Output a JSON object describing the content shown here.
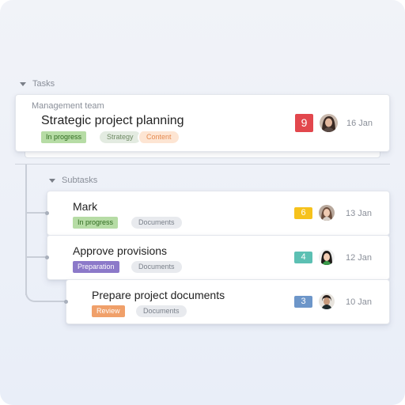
{
  "tasks_section": {
    "label": "Tasks"
  },
  "main_task": {
    "team": "Management team",
    "title": "Strategic project planning",
    "status": "In progress",
    "tags": [
      "Strategy",
      "Content"
    ],
    "count": "9",
    "date": "16 Jan"
  },
  "subtasks_section": {
    "label": "Subtasks"
  },
  "subtasks": [
    {
      "title": "Mark",
      "status": "In progress",
      "tag": "Documents",
      "count": "6",
      "date": "13 Jan"
    },
    {
      "title": "Approve provisions",
      "status": "Preparation",
      "tag": "Documents",
      "count": "4",
      "date": "12 Jan"
    },
    {
      "title": "Prepare project documents",
      "status": "Review",
      "tag": "Documents",
      "count": "3",
      "date": "10 Jan"
    }
  ],
  "colors": {
    "in_progress_bg": "#b6dca5",
    "in_progress_text": "#2f6b1f",
    "preparation_bg": "#8c79c9",
    "review_bg": "#f0a06a",
    "count_red": "#e2474d",
    "count_yellow": "#f6c21c",
    "count_teal": "#5cc0b3",
    "count_blue": "#6d96c9"
  }
}
